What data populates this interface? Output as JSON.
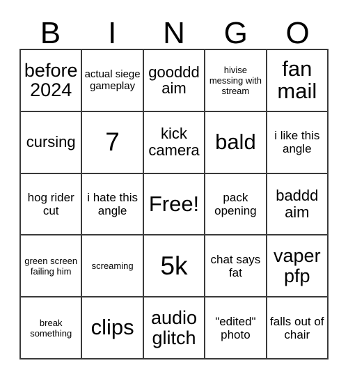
{
  "card": {
    "title": "BINGO",
    "header_letters": [
      "B",
      "I",
      "N",
      "G",
      "O"
    ],
    "free_space_label": "Free!",
    "border_color": "#3a3a3a",
    "background_color": "#ffffff",
    "text_color": "#000000",
    "rows": 5,
    "columns": 5
  },
  "cells": [
    {
      "text": "before 2024",
      "size": "fs-lg",
      "row": 1,
      "col": 1
    },
    {
      "text": "actual siege gameplay",
      "size": "fs-xs",
      "row": 1,
      "col": 2
    },
    {
      "text": "gooddd aim",
      "size": "fs-md",
      "row": 1,
      "col": 3
    },
    {
      "text": "hivise messing with stream",
      "size": "fs-xxs",
      "row": 1,
      "col": 4
    },
    {
      "text": "fan mail",
      "size": "fs-xl",
      "row": 1,
      "col": 5
    },
    {
      "text": "cursing",
      "size": "fs-md",
      "row": 2,
      "col": 1
    },
    {
      "text": "7",
      "size": "fs-xxl",
      "row": 2,
      "col": 2
    },
    {
      "text": "kick camera",
      "size": "fs-md",
      "row": 2,
      "col": 3
    },
    {
      "text": "bald",
      "size": "fs-xl",
      "row": 2,
      "col": 4
    },
    {
      "text": "i like this angle",
      "size": "fs-sm",
      "row": 2,
      "col": 5
    },
    {
      "text": "hog rider cut",
      "size": "fs-sm",
      "row": 3,
      "col": 1
    },
    {
      "text": "i hate this angle",
      "size": "fs-sm",
      "row": 3,
      "col": 2
    },
    {
      "text": "Free!",
      "size": "fs-xl",
      "row": 3,
      "col": 3
    },
    {
      "text": "pack opening",
      "size": "fs-sm",
      "row": 3,
      "col": 4
    },
    {
      "text": "baddd aim",
      "size": "fs-md",
      "row": 3,
      "col": 5
    },
    {
      "text": "green screen failing him",
      "size": "fs-xxs",
      "row": 4,
      "col": 1
    },
    {
      "text": "screaming",
      "size": "fs-xxs",
      "row": 4,
      "col": 2
    },
    {
      "text": "5k",
      "size": "fs-xxl",
      "row": 4,
      "col": 3
    },
    {
      "text": "chat says fat",
      "size": "fs-sm",
      "row": 4,
      "col": 4
    },
    {
      "text": "vaper pfp",
      "size": "fs-lg",
      "row": 4,
      "col": 5
    },
    {
      "text": "break something",
      "size": "fs-xxs",
      "row": 5,
      "col": 1
    },
    {
      "text": "clips",
      "size": "fs-xl",
      "row": 5,
      "col": 2
    },
    {
      "text": "audio glitch",
      "size": "fs-lg",
      "row": 5,
      "col": 3
    },
    {
      "text": "\"edited\" photo",
      "size": "fs-sm",
      "row": 5,
      "col": 4
    },
    {
      "text": "falls out of chair",
      "size": "fs-sm",
      "row": 5,
      "col": 5
    }
  ]
}
